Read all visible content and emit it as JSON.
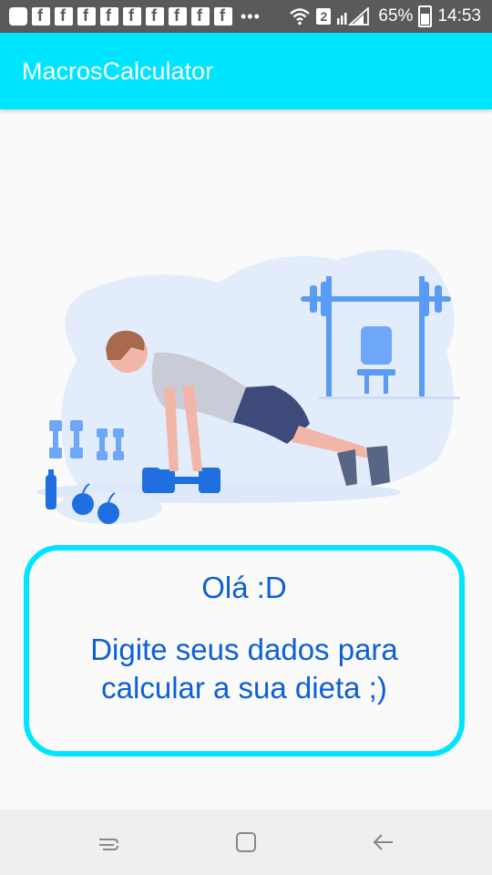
{
  "status_bar": {
    "battery": "65%",
    "time": "14:53",
    "sim_badge": "2",
    "notification_icons": [
      "chat-icon",
      "facebook-icon",
      "facebook-icon",
      "facebook-icon",
      "facebook-icon",
      "facebook-icon",
      "facebook-icon",
      "facebook-icon",
      "facebook-icon",
      "facebook-icon"
    ],
    "more_indicator": "•••"
  },
  "app_bar": {
    "title": "MacrosCalculator"
  },
  "message": {
    "greeting": "Olá :D",
    "body": "Digite seus dados para calcular a sua dieta ;)"
  },
  "colors": {
    "accent": "#00e5ff",
    "text_blue": "#0d5fd8",
    "illustration_blue": "#5a9bf6",
    "illustration_bg": "#e3ecfa"
  },
  "nav_bar": {
    "recent_icon": "recent-apps-icon",
    "home_icon": "home-icon",
    "back_icon": "back-icon"
  }
}
